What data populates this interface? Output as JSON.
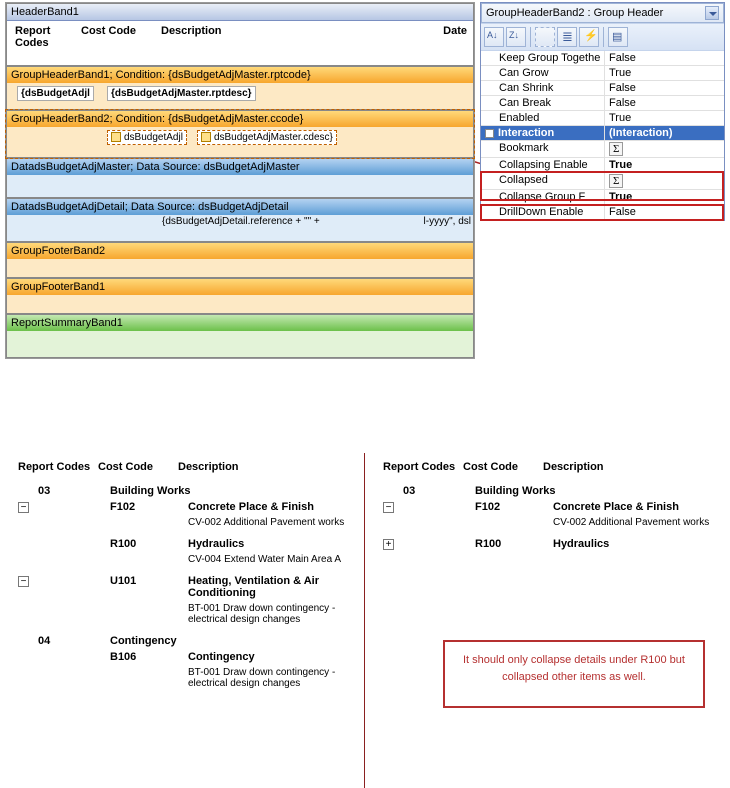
{
  "designer": {
    "header_band": "HeaderBand1",
    "cols": {
      "report_codes": "Report Codes",
      "cost_code": "Cost Code",
      "description": "Description",
      "date": "Date"
    },
    "ghb1": {
      "title": "GroupHeaderBand1; Condition: {dsBudgetAdjMaster.rptcode}",
      "c1": "{dsBudgetAdjl",
      "c2": "{dsBudgetAdjMaster.rptdesc}"
    },
    "ghb2": {
      "title": "GroupHeaderBand2; Condition: {dsBudgetAdjMaster.ccode}",
      "c1": "dsBudgetAdjl",
      "c2": "dsBudgetAdjMaster.cdesc}"
    },
    "data1": "DatadsBudgetAdjMaster; Data Source: dsBudgetAdjMaster",
    "data2": {
      "title": "DatadsBudgetAdjDetail; Data Source: dsBudgetAdjDetail",
      "c1": "{dsBudgetAdjDetail.reference + \"\" +",
      "c2": "l-yyyy\", dsl"
    },
    "gfb2": "GroupFooterBand2",
    "gfb1": "GroupFooterBand1",
    "rsb": "ReportSummaryBand1"
  },
  "props": {
    "combo": "GroupHeaderBand2 : Group Header",
    "rows": [
      {
        "k": "Keep Group Togethe",
        "v": "False"
      },
      {
        "k": "Can Grow",
        "v": "True"
      },
      {
        "k": "Can Shrink",
        "v": "False"
      },
      {
        "k": "Can Break",
        "v": "False"
      },
      {
        "k": "Enabled",
        "v": "True"
      }
    ],
    "cat": {
      "k": "Interaction",
      "v": "(Interaction)"
    },
    "sub": [
      {
        "k": "Bookmark",
        "v": "Σ"
      },
      {
        "k": "Collapsing Enable",
        "v": "True",
        "hl": true
      },
      {
        "k": "Collapsed",
        "v": "Σ"
      },
      {
        "k": "Collapse Group F",
        "v": "True",
        "hl": true
      },
      {
        "k": "DrillDown Enable",
        "v": "False"
      }
    ]
  },
  "report_l": {
    "hdr": {
      "c1": "Report Codes",
      "c2": "Cost Code",
      "c3": "Description"
    },
    "g1": {
      "code": "03",
      "name": "Building Works"
    },
    "r1": {
      "cc": "F102",
      "desc": "Concrete Place & Finish",
      "det": "CV-002 Additional Pavement works"
    },
    "r2": {
      "cc": "R100",
      "desc": "Hydraulics",
      "det": "CV-004 Extend Water Main Area A"
    },
    "r3": {
      "cc": "U101",
      "desc": "Heating, Ventilation & Air Conditioning",
      "det": "BT-001 Draw down contingency - electrical design changes"
    },
    "g2": {
      "code": "04",
      "name": "Contingency"
    },
    "r4": {
      "cc": "B106",
      "desc": "Contingency",
      "det": "BT-001 Draw down contingency - electrical design changes"
    }
  },
  "report_r": {
    "hdr": {
      "c1": "Report Codes",
      "c2": "Cost Code",
      "c3": "Description"
    },
    "g1": {
      "code": "03",
      "name": "Building Works"
    },
    "r1": {
      "cc": "F102",
      "desc": "Concrete Place & Finish",
      "det": "CV-002 Additional Pavement works"
    },
    "r2": {
      "cc": "R100",
      "desc": "Hydraulics"
    }
  },
  "callout": "It should only collapse details under R100 but collapsed other items as well."
}
